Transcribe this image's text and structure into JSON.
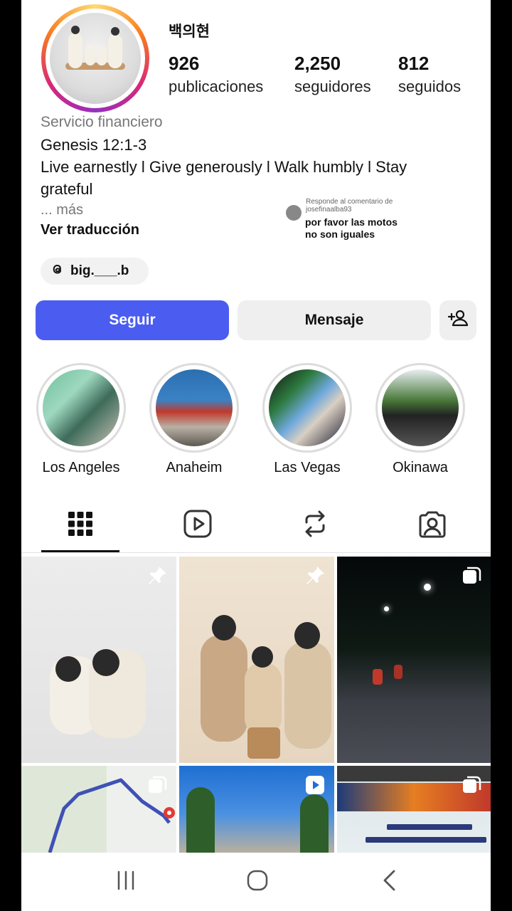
{
  "profile": {
    "username": "백의현",
    "stats": [
      {
        "value": "926",
        "label": "publicaciones"
      },
      {
        "value": "2,250",
        "label": "seguidores"
      },
      {
        "value": "812",
        "label": "seguidos"
      }
    ],
    "category": "Servicio financiero",
    "bio_lines": [
      "Genesis 12:1-3",
      "Live earnestly l Give generously l Walk humbly l Stay",
      "grateful"
    ],
    "more": "... más",
    "translate": "Ver traducción",
    "threads_handle": "big.___.b"
  },
  "comment_overlay": {
    "header": "Responde al comentario de josefinaalba93",
    "text": "por favor las motos no son iguales"
  },
  "actions": {
    "follow": "Seguir",
    "message": "Mensaje"
  },
  "highlights": [
    {
      "label": "Los Angeles"
    },
    {
      "label": "Anaheim"
    },
    {
      "label": "Las Vegas"
    },
    {
      "label": "Okinawa"
    }
  ],
  "tabs": [
    "grid-icon",
    "reels-icon",
    "reposts-icon",
    "tagged-icon"
  ],
  "colors": {
    "accent": "#4a5df0",
    "story_ring": "#d62976"
  }
}
